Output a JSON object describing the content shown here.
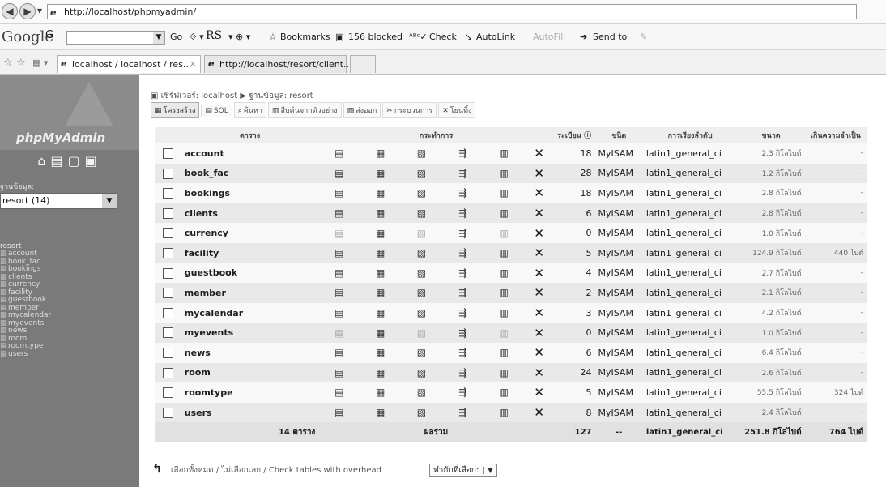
{
  "browser": {
    "url": "http://localhost/phpmyadmin/",
    "toolbar": {
      "google_logo": "Google",
      "g_label": "G",
      "go": "Go",
      "rs": "RS",
      "bookmarks": "Bookmarks",
      "blocked": "156 blocked",
      "check": "Check",
      "autolink": "AutoLink",
      "autofill": "AutoFill",
      "send_to": "Send to"
    },
    "tabs": [
      {
        "label": "localhost / localhost / res...",
        "active": true
      },
      {
        "label": "http://localhost/resort/client...",
        "active": false
      }
    ]
  },
  "sidebar": {
    "logo": "phpMyAdmin",
    "db_label": "ฐานข้อมูล:",
    "db_select": "resort (14)",
    "tree_title": "resort",
    "tables": [
      "account",
      "book_fac",
      "bookings",
      "clients",
      "currency",
      "facility",
      "guestbook",
      "member",
      "mycalendar",
      "myevents",
      "news",
      "room",
      "roomtype",
      "users"
    ]
  },
  "main": {
    "breadcrumb": "เซิร์ฟเวอร์: localhost ▶ ฐานข้อมูล: resort",
    "tabs": [
      "โครงสร้าง",
      "SQL",
      "ค้นหา",
      "สืบค้นจากตัวอย่าง",
      "ส่งออก",
      "กระบวนการ",
      "โยนทิ้ง"
    ],
    "headers": {
      "table": "ตาราง",
      "action": "กระทำการ",
      "records": "ระเบียน",
      "type": "ชนิด",
      "collation": "การเรียงลำดับ",
      "size": "ขนาด",
      "overhead": "เกินความจำเป็น"
    },
    "rows": [
      {
        "name": "account",
        "records": "18",
        "engine": "MyISAM",
        "collation": "latin1_general_ci",
        "size": "2.3 กิโลไบต์",
        "overhead": "-",
        "empty": false
      },
      {
        "name": "book_fac",
        "records": "28",
        "engine": "MyISAM",
        "collation": "latin1_general_ci",
        "size": "1.2 กิโลไบต์",
        "overhead": "-",
        "empty": false
      },
      {
        "name": "bookings",
        "records": "18",
        "engine": "MyISAM",
        "collation": "latin1_general_ci",
        "size": "2.8 กิโลไบต์",
        "overhead": "-",
        "empty": false
      },
      {
        "name": "clients",
        "records": "6",
        "engine": "MyISAM",
        "collation": "latin1_general_ci",
        "size": "2.8 กิโลไบต์",
        "overhead": "-",
        "empty": false
      },
      {
        "name": "currency",
        "records": "0",
        "engine": "MyISAM",
        "collation": "latin1_general_ci",
        "size": "1.0 กิโลไบต์",
        "overhead": "-",
        "empty": true
      },
      {
        "name": "facility",
        "records": "5",
        "engine": "MyISAM",
        "collation": "latin1_general_ci",
        "size": "124.9 กิโลไบต์",
        "overhead": "440 ไบต์",
        "empty": false
      },
      {
        "name": "guestbook",
        "records": "4",
        "engine": "MyISAM",
        "collation": "latin1_general_ci",
        "size": "2.7 กิโลไบต์",
        "overhead": "-",
        "empty": false
      },
      {
        "name": "member",
        "records": "2",
        "engine": "MyISAM",
        "collation": "latin1_general_ci",
        "size": "2.1 กิโลไบต์",
        "overhead": "-",
        "empty": false
      },
      {
        "name": "mycalendar",
        "records": "3",
        "engine": "MyISAM",
        "collation": "latin1_general_ci",
        "size": "4.2 กิโลไบต์",
        "overhead": "-",
        "empty": false
      },
      {
        "name": "myevents",
        "records": "0",
        "engine": "MyISAM",
        "collation": "latin1_general_ci",
        "size": "1.0 กิโลไบต์",
        "overhead": "-",
        "empty": true
      },
      {
        "name": "news",
        "records": "6",
        "engine": "MyISAM",
        "collation": "latin1_general_ci",
        "size": "6.4 กิโลไบต์",
        "overhead": "-",
        "empty": false
      },
      {
        "name": "room",
        "records": "24",
        "engine": "MyISAM",
        "collation": "latin1_general_ci",
        "size": "2.6 กิโลไบต์",
        "overhead": "-",
        "empty": false
      },
      {
        "name": "roomtype",
        "records": "5",
        "engine": "MyISAM",
        "collation": "latin1_general_ci",
        "size": "55.5 กิโลไบต์",
        "overhead": "324 ไบต์",
        "empty": false
      },
      {
        "name": "users",
        "records": "8",
        "engine": "MyISAM",
        "collation": "latin1_general_ci",
        "size": "2.4 กิโลไบต์",
        "overhead": "-",
        "empty": false
      }
    ],
    "totals": {
      "label": "14 ตาราง",
      "sum_label": "ผลรวม",
      "records": "127",
      "engine": "--",
      "collation": "latin1_general_ci",
      "size": "251.8 กิโลไบต์",
      "overhead": "764 ไบต์"
    },
    "footer": {
      "check_all": "เลือกทั้งหมด",
      "uncheck_all": "ไม่เลือกเลย",
      "check_overhead": "Check tables with overhead",
      "with_selected": "ทำกับที่เลือก:"
    }
  }
}
